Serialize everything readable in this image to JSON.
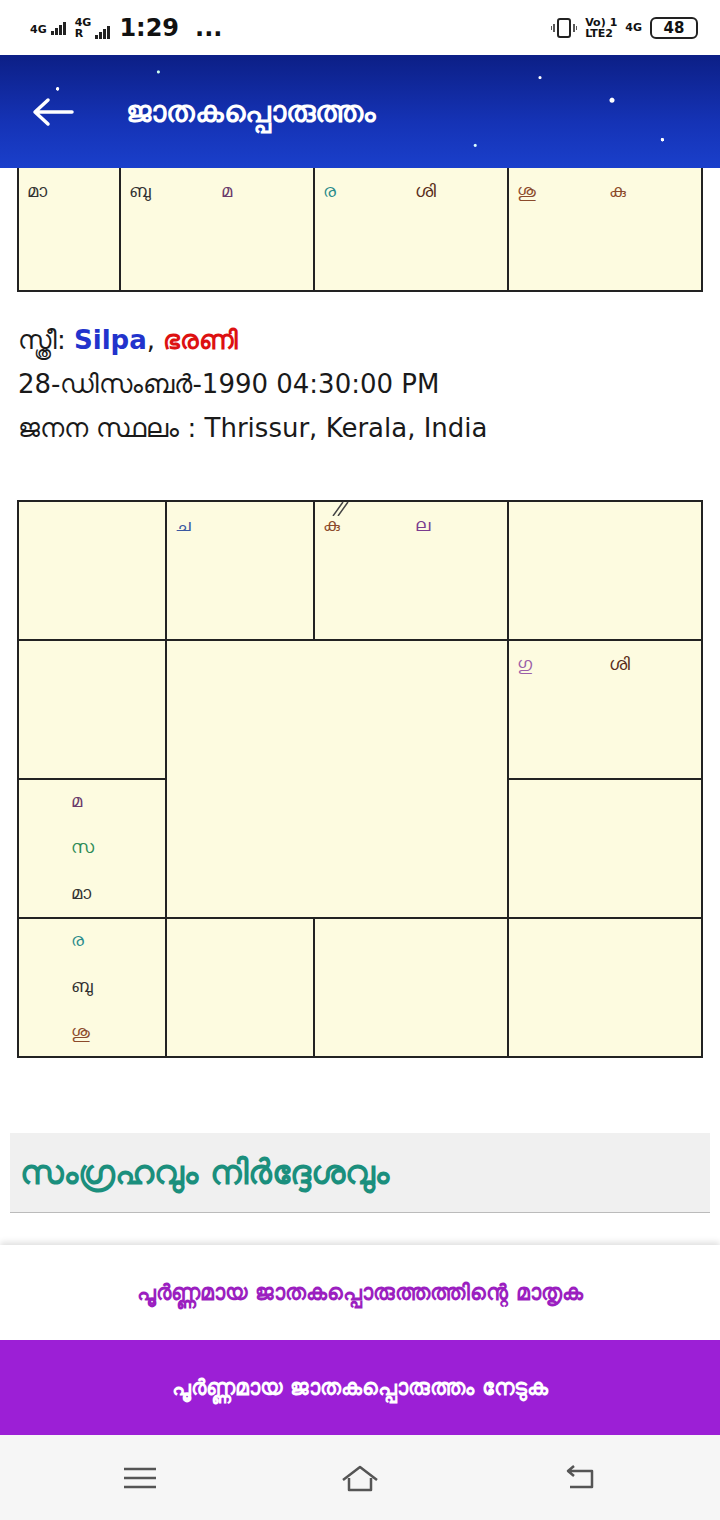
{
  "status_bar": {
    "network1": "4G",
    "network2": "4G",
    "roaming": "R",
    "time": "1:29",
    "more": "...",
    "volte": "Vo)",
    "sim": "1",
    "lte": "LTE2",
    "network3": "4G",
    "battery": "48"
  },
  "app_bar": {
    "title": "ജാതകപ്പൊരുത്തം"
  },
  "top_chart": {
    "cells": [
      {
        "kind": "row",
        "planets": [
          {
            "text": "മാ",
            "color": "#333333",
            "retro": false
          }
        ]
      },
      {
        "kind": "row",
        "planets": [
          {
            "text": "ബു",
            "color": "#333333",
            "retro": false
          },
          {
            "text": "മ",
            "color": "#6b3a6b",
            "retro": false
          }
        ]
      },
      {
        "kind": "row",
        "planets": [
          {
            "text": "ര",
            "color": "#2a8c8c",
            "retro": false
          },
          {
            "text": "ശി",
            "color": "#5a2d1a",
            "retro": false
          }
        ]
      },
      {
        "kind": "row",
        "planets": [
          {
            "text": "ശു",
            "color": "#8b4a2b",
            "retro": false
          },
          {
            "text": "കു",
            "color": "#8b4a2b",
            "retro": false
          }
        ]
      }
    ]
  },
  "person": {
    "label": "സ്ത്രീ",
    "separator": ":",
    "name": "Silpa",
    "name_sep": ",",
    "star": "ഭരണി",
    "birth": "28-ഡിസംബർ-1990 04:30:00 PM",
    "place_label": "ജനന സ്ഥലം",
    "place_sep": ":",
    "place": "Thrissur, Kerala, India"
  },
  "chart": {
    "cells": [
      {
        "kind": "row",
        "planets": []
      },
      {
        "kind": "row",
        "planets": [
          {
            "text": "ച",
            "color": "#3a57a0",
            "retro": false
          }
        ]
      },
      {
        "kind": "row",
        "planets": [
          {
            "text": "കു",
            "color": "#8b4a2b",
            "retro": true
          },
          {
            "text": "ല",
            "color": "#7a3b8f",
            "retro": false
          }
        ]
      },
      {
        "kind": "row",
        "planets": []
      },
      {
        "kind": "row",
        "planets": []
      },
      {
        "kind": "row",
        "planets": [
          {
            "text": "ഗു",
            "color": "#9b5fa8",
            "retro": false
          },
          {
            "text": "ശി",
            "color": "#5a2d1a",
            "retro": false
          }
        ]
      },
      {
        "kind": "column",
        "planets": [
          {
            "text": "മ",
            "color": "#6b3a6b",
            "retro": false
          },
          {
            "text": "സ",
            "color": "#2e8b57",
            "retro": false
          },
          {
            "text": "മാ",
            "color": "#333333",
            "retro": false
          }
        ]
      },
      {
        "kind": "row",
        "planets": []
      },
      {
        "kind": "column",
        "planets": [
          {
            "text": "ര",
            "color": "#2a8c8c",
            "retro": false
          },
          {
            "text": "ബു",
            "color": "#333333",
            "retro": false
          },
          {
            "text": "ശു",
            "color": "#8b4a2b",
            "retro": false
          }
        ]
      },
      {
        "kind": "row",
        "planets": []
      },
      {
        "kind": "row",
        "planets": []
      },
      {
        "kind": "row",
        "planets": []
      }
    ]
  },
  "summary": {
    "title": "സംഗ്രഹവും നിർദ്ദേശവും"
  },
  "sample_link": "പൂർണ്ണമായ ജാതകപ്പൊരുത്തത്തിന്റെ മാതൃക",
  "get_button": "പൂർണ്ണമായ ജാതകപ്പൊരുത്തം നേടുക"
}
